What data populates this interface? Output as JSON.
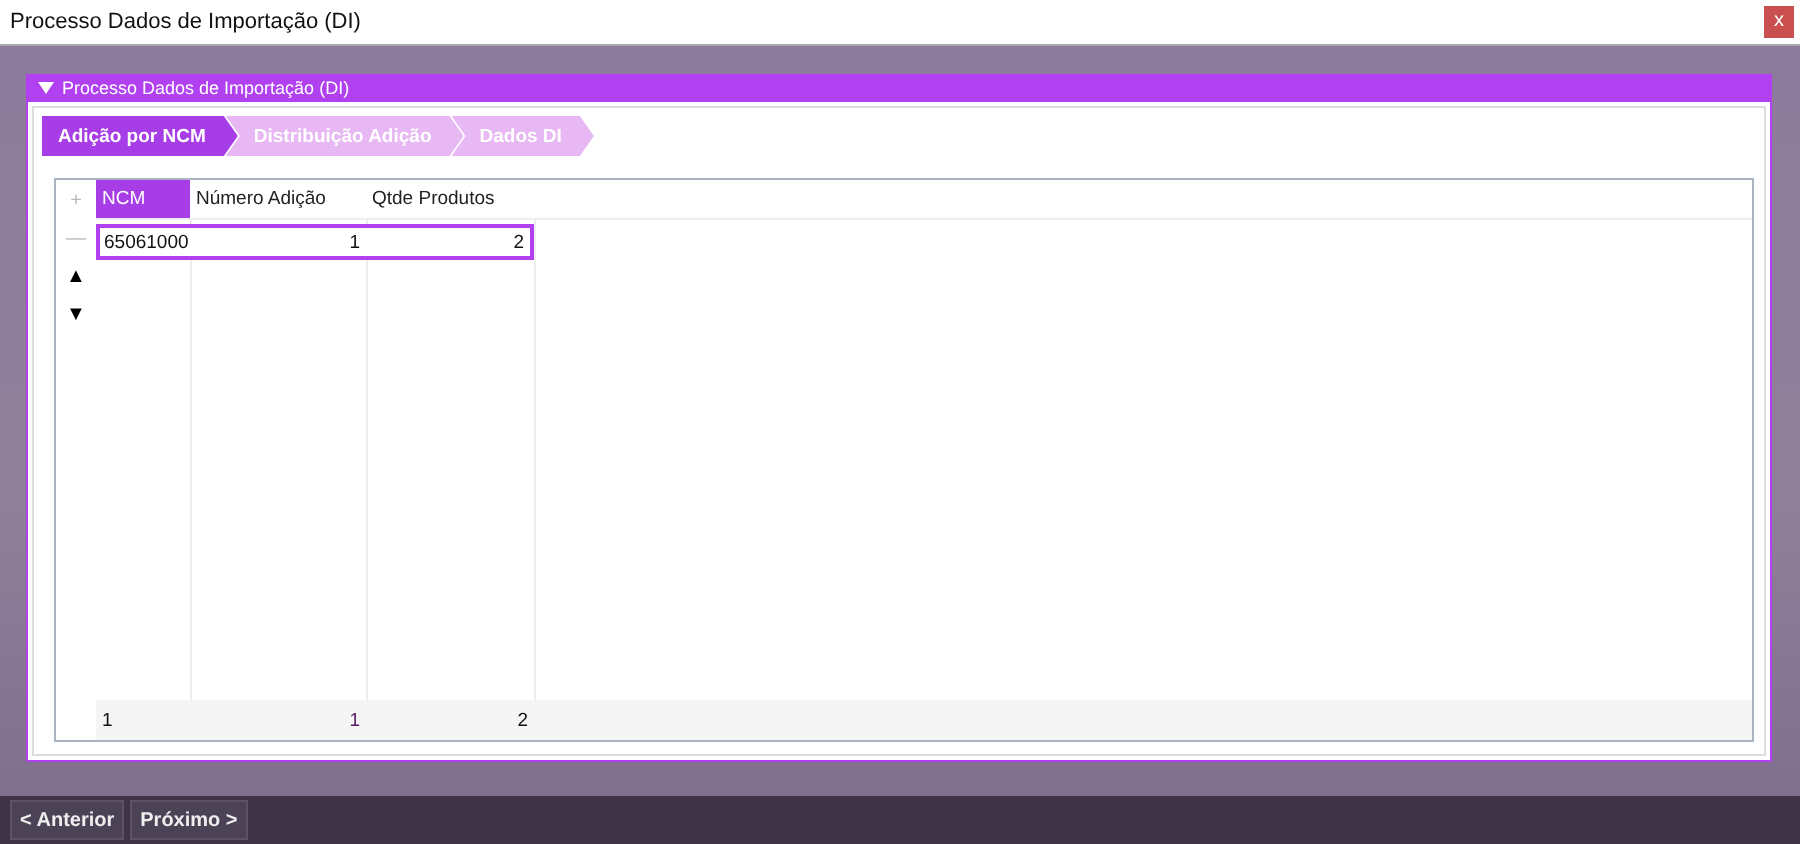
{
  "window": {
    "title": "Processo Dados de Importação (DI)",
    "close": "x"
  },
  "panel": {
    "title": "Processo Dados de Importação (DI)",
    "expanded": true
  },
  "steps": [
    {
      "label": "Adição por NCM",
      "selected": true
    },
    {
      "label": "Distribuição Adição",
      "selected": false
    },
    {
      "label": "Dados DI",
      "selected": false
    }
  ],
  "grid": {
    "tools": [
      {
        "glyph": "+",
        "disabled": true
      },
      {
        "glyph": "—",
        "disabled": true
      },
      {
        "glyph": "▲",
        "disabled": false
      },
      {
        "glyph": "▼",
        "disabled": false
      }
    ],
    "columns": [
      {
        "label": "NCM",
        "selected": true
      },
      {
        "label": "Número Adição",
        "selected": false
      },
      {
        "label": "Qtde Produtos",
        "selected": false
      }
    ],
    "rows": [
      {
        "cells": [
          "65061000",
          "1",
          "2"
        ],
        "selected": true
      }
    ],
    "totals": [
      "1",
      "1",
      "2"
    ]
  },
  "buttons": [
    "< Anterior",
    "Próximo >"
  ]
}
